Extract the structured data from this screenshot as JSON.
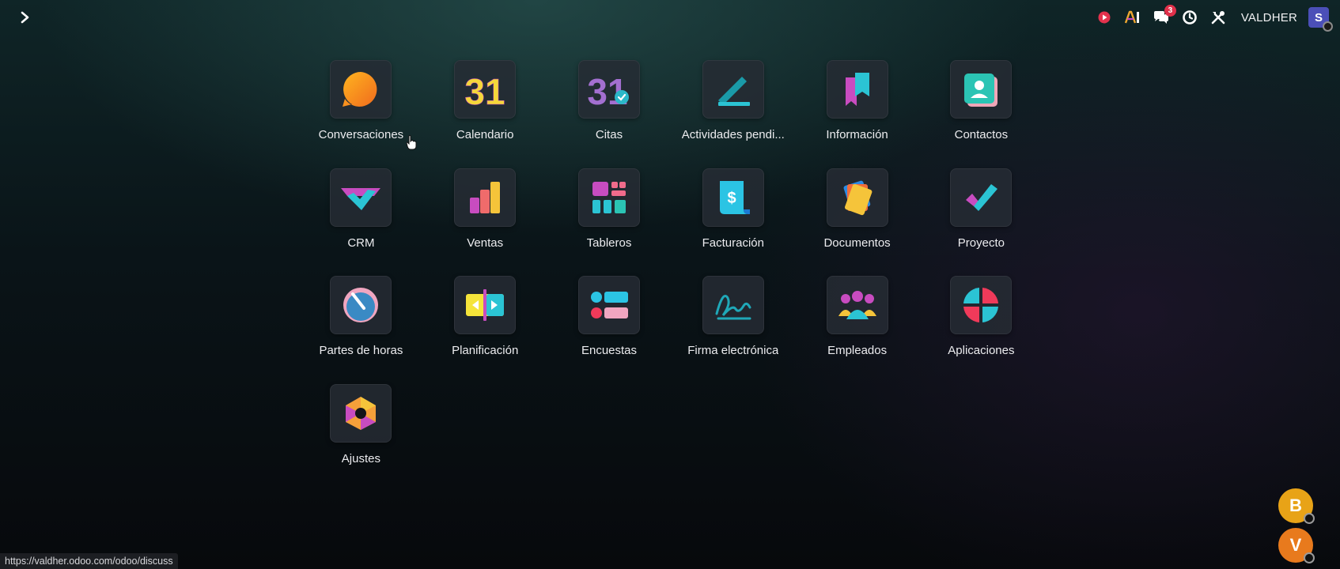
{
  "topbar": {
    "menu_icon": "chevron-right-icon",
    "systray": {
      "record_icon": "record-icon",
      "ai_label": "AI",
      "messages_badge": "3",
      "activity_icon": "clock-icon",
      "tools_icon": "tools-icon",
      "company_name": "VALDHER",
      "user_initial": "S",
      "user_color": "#4b4fb8"
    }
  },
  "apps": [
    {
      "label": "Conversaciones",
      "icon": "discuss-icon"
    },
    {
      "label": "Calendario",
      "icon": "calendar-icon",
      "day": "31"
    },
    {
      "label": "Citas",
      "icon": "appointment-icon",
      "day": "31"
    },
    {
      "label": "Actividades pendi...",
      "icon": "activity-pen-icon"
    },
    {
      "label": "Información",
      "icon": "knowledge-icon"
    },
    {
      "label": "Contactos",
      "icon": "contacts-icon"
    },
    {
      "label": "CRM",
      "icon": "crm-handshake-icon"
    },
    {
      "label": "Ventas",
      "icon": "sales-chart-icon"
    },
    {
      "label": "Tableros",
      "icon": "dashboard-icon"
    },
    {
      "label": "Facturación",
      "icon": "invoice-icon",
      "symbol": "$"
    },
    {
      "label": "Documentos",
      "icon": "documents-icon"
    },
    {
      "label": "Proyecto",
      "icon": "project-check-icon"
    },
    {
      "label": "Partes de horas",
      "icon": "timesheet-dial-icon"
    },
    {
      "label": "Planificación",
      "icon": "planning-icon"
    },
    {
      "label": "Encuestas",
      "icon": "survey-icon"
    },
    {
      "label": "Firma electrónica",
      "icon": "signature-icon"
    },
    {
      "label": "Empleados",
      "icon": "employees-icon"
    },
    {
      "label": "Aplicaciones",
      "icon": "apps-icon"
    },
    {
      "label": "Ajustes",
      "icon": "settings-hex-icon"
    }
  ],
  "status_bar": {
    "url": "https://valdher.odoo.com/odoo/discuss"
  },
  "chat_bubbles": [
    {
      "initial": "B",
      "color": "#e8a317"
    },
    {
      "initial": "V",
      "color": "#e87a1d"
    }
  ]
}
